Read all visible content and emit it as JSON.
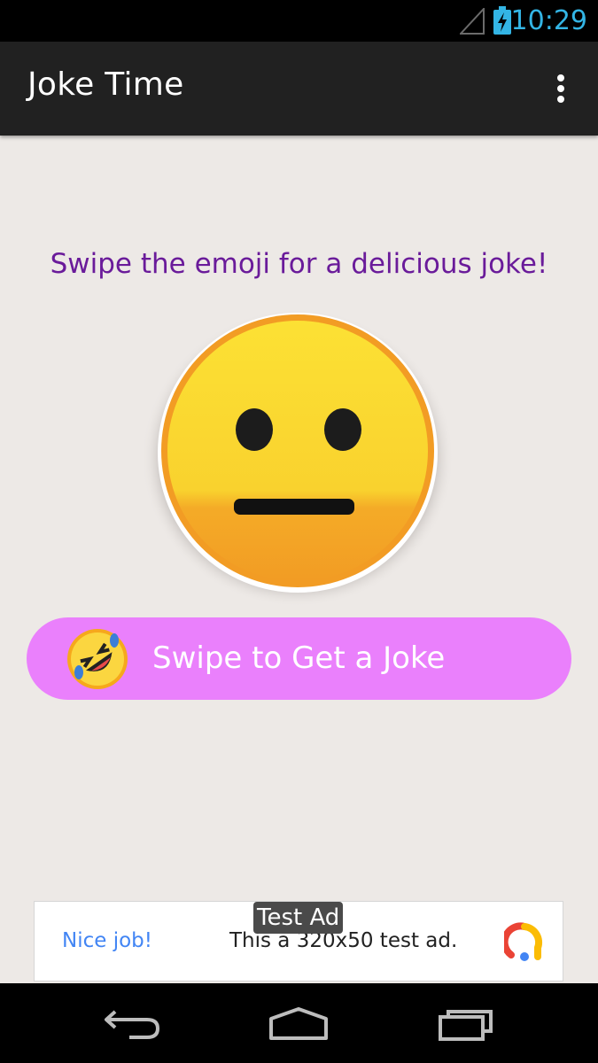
{
  "status_bar": {
    "time": "10:29",
    "signal_icon": "signal-icon",
    "battery_icon": "battery-charging-icon"
  },
  "action_bar": {
    "title": "Joke Time",
    "overflow_icon": "more-vert-icon"
  },
  "main": {
    "prompt": "Swipe the emoji for a delicious joke!",
    "emoji_icon": "neutral-face-emoji",
    "swipe_button": {
      "label": "Swipe to Get a Joke",
      "thumb_icon": "rofl-emoji-icon"
    }
  },
  "ad": {
    "tag": "Test Ad",
    "cta": "Nice job!",
    "text": "This a 320x50 test ad.",
    "logo_icon": "ad-logo-icon"
  },
  "nav_bar": {
    "back_icon": "back-icon",
    "home_icon": "home-icon",
    "recents_icon": "recents-icon"
  },
  "colors": {
    "accent_purple": "#6a1b9a",
    "button_pink": "#ea80fc",
    "clock_blue": "#33b5e5",
    "ad_link_blue": "#4285f4"
  }
}
